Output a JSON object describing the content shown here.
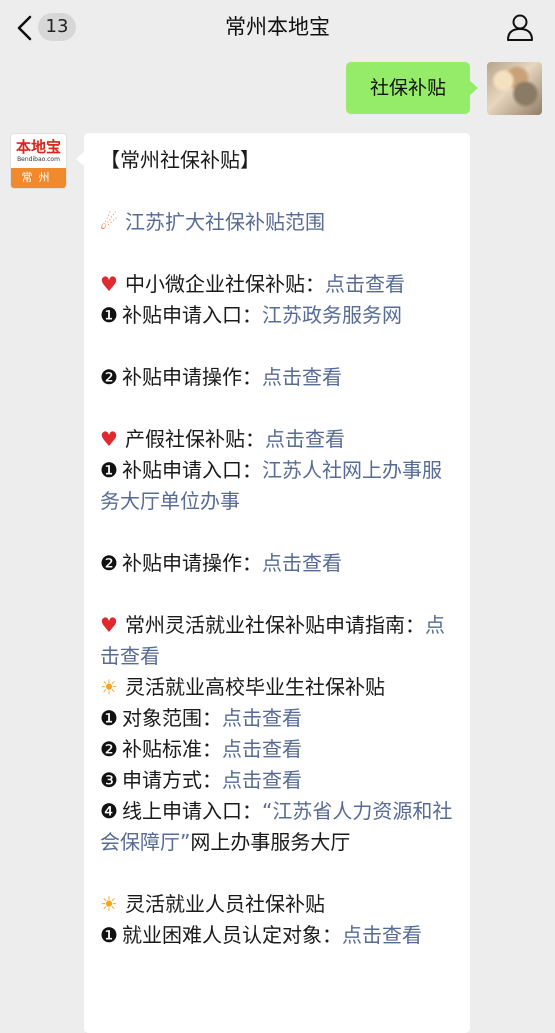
{
  "nav": {
    "unread_count": "13",
    "title": "常州本地宝"
  },
  "my_message": {
    "text": "社保补贴"
  },
  "bot_avatar": {
    "logo_text": "本地宝",
    "logo_sub": "Bendibao.com",
    "city": "常州"
  },
  "reply": {
    "heading": "【常州社保补贴】",
    "expand_link": "江苏扩大社保补贴范围",
    "sme": {
      "label": "中小微企业社保补贴：",
      "link": "点击查看",
      "entry_label": "补贴申请入口：",
      "entry_link": "江苏政务服务网",
      "op_label": "补贴申请操作：",
      "op_link": "点击查看"
    },
    "maternity": {
      "label": "产假社保补贴：",
      "link": "点击查看",
      "entry_label": "补贴申请入口：",
      "entry_link": "江苏人社网上办事服务大厅单位办事",
      "op_label": "补贴申请操作：",
      "op_link": "点击查看"
    },
    "flexible_guide": {
      "label": "常州灵活就业社保补贴申请指南：",
      "link": "点击查看"
    },
    "graduates": {
      "label": "灵活就业高校毕业生社保补贴",
      "scope_label": "对象范围：",
      "scope_link": "点击查看",
      "standard_label": "补贴标准：",
      "standard_link": "点击查看",
      "method_label": "申请方式：",
      "method_link": "点击查看",
      "online_label": "线上申请入口：",
      "online_link": "“江苏省人力资源和社会保障厅”",
      "online_suffix": "网上办事服务大厅"
    },
    "flexible_staff": {
      "label": "灵活就业人员社保补贴",
      "hardship_label": "就业困难人员认定对象：",
      "hardship_link": "点击查看"
    },
    "bullets": {
      "n1": "❶",
      "n2": "❷",
      "n3": "❸",
      "n4": "❹"
    },
    "icons": {
      "expand": "fire-icon",
      "heart": "heart-icon",
      "sun": "sun-icon"
    }
  },
  "colors": {
    "link": "#576b95",
    "my_bubble": "#95ec69",
    "background": "#ededed"
  }
}
